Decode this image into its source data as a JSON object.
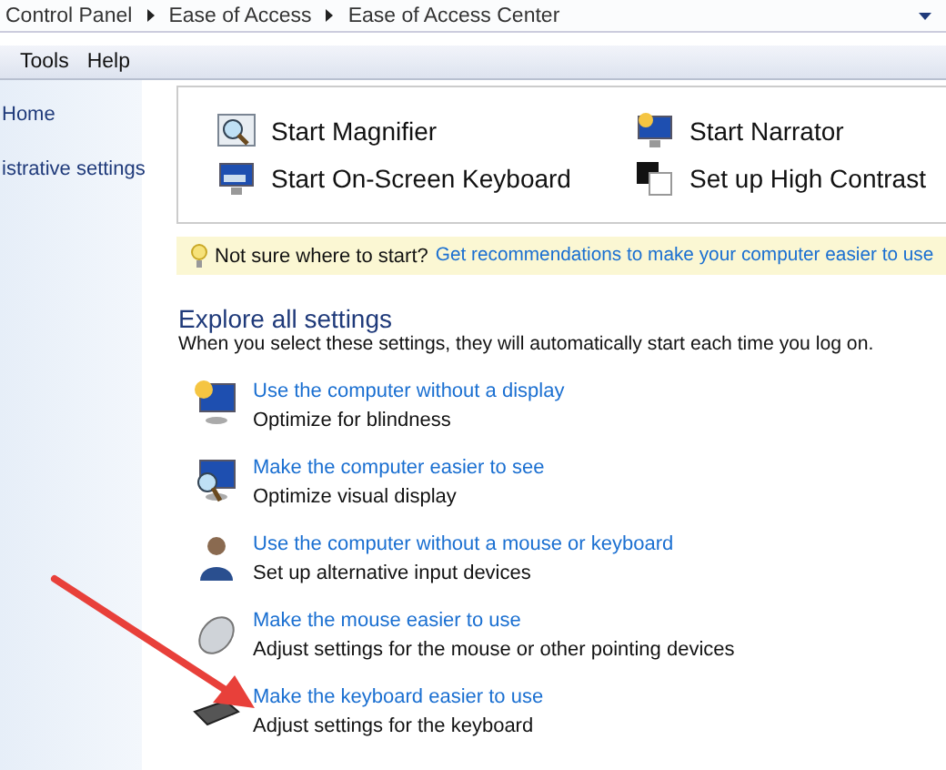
{
  "address_bar": {
    "crumbs": [
      "Control Panel",
      "Ease of Access",
      "Ease of Access Center"
    ]
  },
  "menu": [
    "Tools",
    "Help"
  ],
  "sidebar": {
    "items": [
      "Home",
      "istrative settings"
    ]
  },
  "quick_access": [
    {
      "kind": "magnifier",
      "label": "Start Magnifier"
    },
    {
      "kind": "narrator",
      "label": "Start Narrator"
    },
    {
      "kind": "keyboard",
      "label": "Start On-Screen Keyboard"
    },
    {
      "kind": "contrast",
      "label": "Set up High Contrast"
    }
  ],
  "tip": {
    "question": "Not sure where to start?",
    "link": "Get recommendations to make your computer easier to use"
  },
  "explore": {
    "heading": "Explore all settings",
    "intro": "When you select these settings, they will automatically start each time you log on.",
    "items": [
      {
        "kind": "display",
        "link": "Use the computer without a display",
        "description": "Optimize for blindness"
      },
      {
        "kind": "see",
        "link": "Make the computer easier to see",
        "description": "Optimize visual display"
      },
      {
        "kind": "person",
        "link": "Use the computer without a mouse or keyboard",
        "description": "Set up alternative input devices"
      },
      {
        "kind": "mouse",
        "link": "Make the mouse easier to use",
        "description": "Adjust settings for the mouse or other pointing devices"
      },
      {
        "kind": "keyboard",
        "link": "Make the keyboard easier to use",
        "description": "Adjust settings for the keyboard"
      }
    ]
  }
}
